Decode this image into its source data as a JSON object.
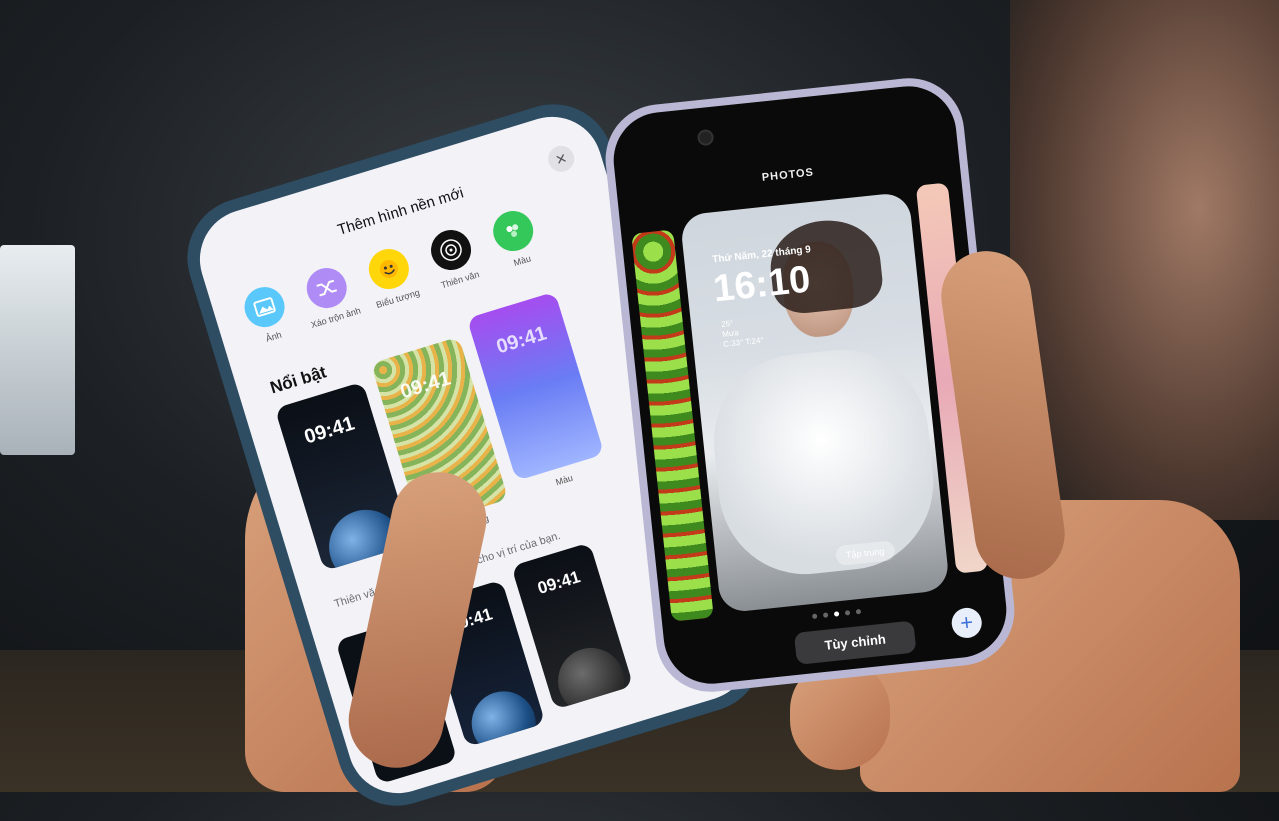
{
  "left_phone": {
    "sheet_title": "Thêm hình nền mới",
    "close_glyph": "×",
    "categories": [
      {
        "label": "Ảnh",
        "icon": "photo-icon",
        "color": "#5ac8fa"
      },
      {
        "label": "Xáo trộn ảnh",
        "icon": "shuffle-icon",
        "color": "#af8cf5"
      },
      {
        "label": "Biểu tượng",
        "icon": "emoji-icon",
        "color": "#ffd60a"
      },
      {
        "label": "Thiên văn",
        "icon": "astronomy-icon",
        "color": "#111111"
      },
      {
        "label": "Màu",
        "icon": "color-icon",
        "color": "#34c759"
      }
    ],
    "section_title": "Nổi bật",
    "featured": [
      {
        "time": "09:41",
        "label": ""
      },
      {
        "time": "09:41",
        "label": "Biểu tượng"
      },
      {
        "time": "09:41",
        "label": "Màu"
      }
    ],
    "astronomy_description": "Thiên văn và thời tiết trực tiếp cho vị trí của bạn.",
    "astronomy_thumbs": [
      {
        "time": "09:41"
      },
      {
        "time": "09:41"
      },
      {
        "time": "09:41"
      }
    ]
  },
  "right_phone": {
    "header": "PHOTOS",
    "date": "Thứ Năm, 22 tháng 9",
    "time": "16:10",
    "weather_temp": "25°",
    "weather_desc": "Mưa",
    "weather_range": "C:33° T:24°",
    "photo_button": "Tập trung",
    "customize_button": "Tùy chỉnh",
    "add_glyph": "+",
    "page_dots": 5,
    "active_dot": 2
  }
}
